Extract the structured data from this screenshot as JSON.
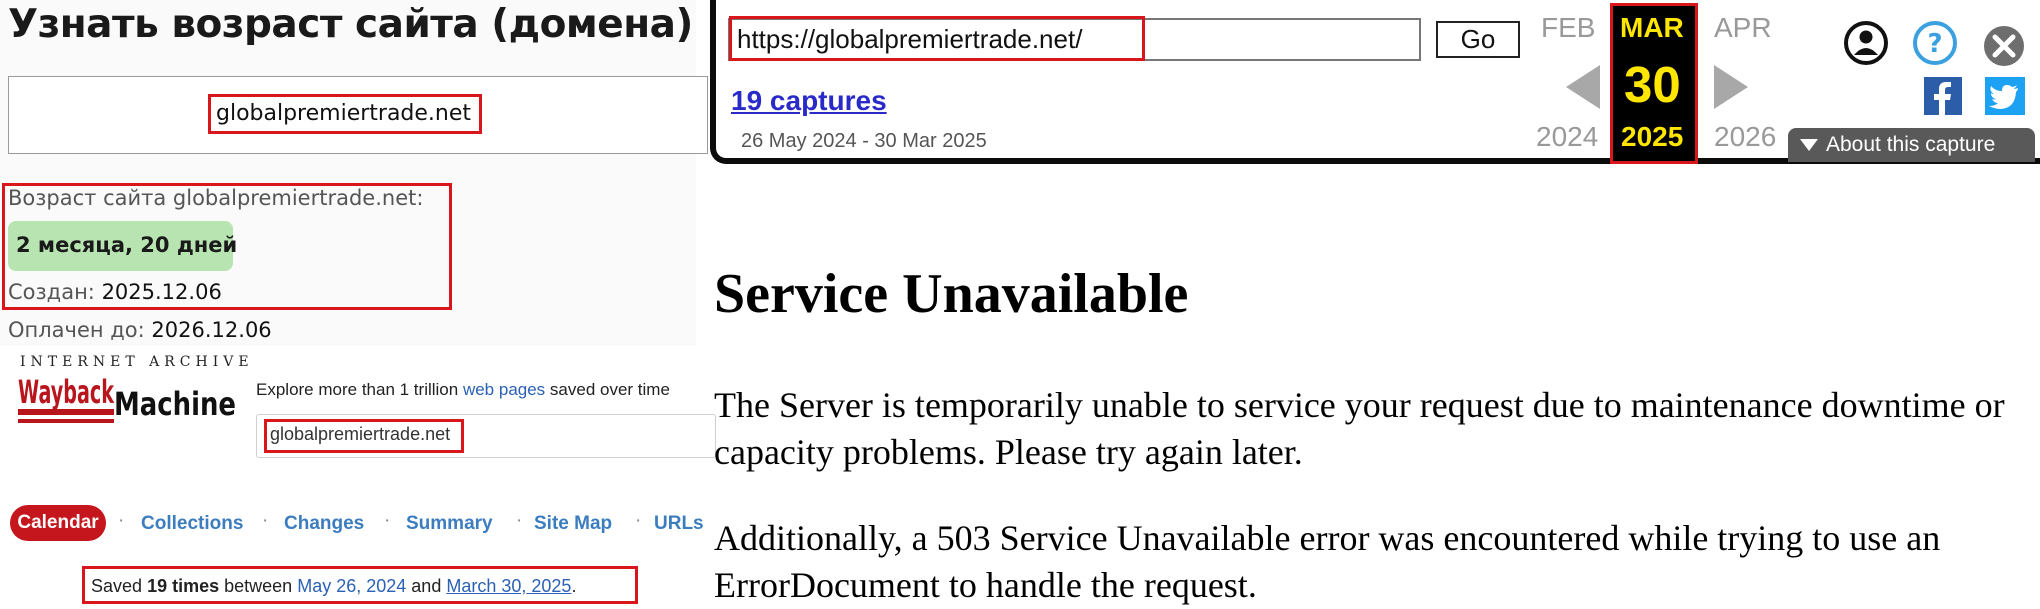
{
  "age_checker": {
    "title": "Узнать возраст сайта (домена)",
    "domain_value": "globalpremiertrade.net",
    "age_label": "Возраст сайта globalpremiertrade.net:",
    "age_value": "2 месяца, 20 дней",
    "created_label": "Создан:",
    "created_value": "2025.12.06",
    "paid_label": "Оплачен до:",
    "paid_value": "2026.12.06"
  },
  "wayback_home": {
    "ia_caption": "INTERNET ARCHIVE",
    "logo_text": "WaybackMachine",
    "explore_pre": "Explore more than 1 trillion",
    "explore_link": "web pages",
    "explore_post": "saved over time",
    "search_value": "globalpremiertrade.net",
    "nav": [
      "Calendar",
      "Collections",
      "Changes",
      "Summary",
      "Site Map",
      "URLs"
    ],
    "saved_pre": "Saved",
    "saved_count": "19 times",
    "saved_between": "between",
    "saved_from": "May 26, 2024",
    "saved_and": "and",
    "saved_to": "March 30, 2025",
    "saved_end": "."
  },
  "toolbar": {
    "url_value": "https://globalpremiertrade.net/",
    "go_label": "Go",
    "captures_link": "19 captures",
    "captures_range": "26 May 2024 - 30 Mar 2025",
    "prev_month": "FEB",
    "cur_month": "MAR",
    "next_month": "APR",
    "prev_year": "2024",
    "cur_day": "30",
    "cur_year": "2025",
    "next_year": "2026",
    "about_label": "About this capture",
    "icons": [
      "user-icon",
      "help-icon",
      "close-icon",
      "facebook-icon",
      "twitter-icon"
    ],
    "accent_color": "#ffe600"
  },
  "error_page": {
    "title": "Service Unavailable",
    "paragraph1": "The Server is temporarily unable to service your request due to maintenance downtime or capacity problems. Please try again later.",
    "paragraph2": "Additionally, a 503 Service Unavailable error was encountered while trying to use an ErrorDocument to handle the request."
  }
}
